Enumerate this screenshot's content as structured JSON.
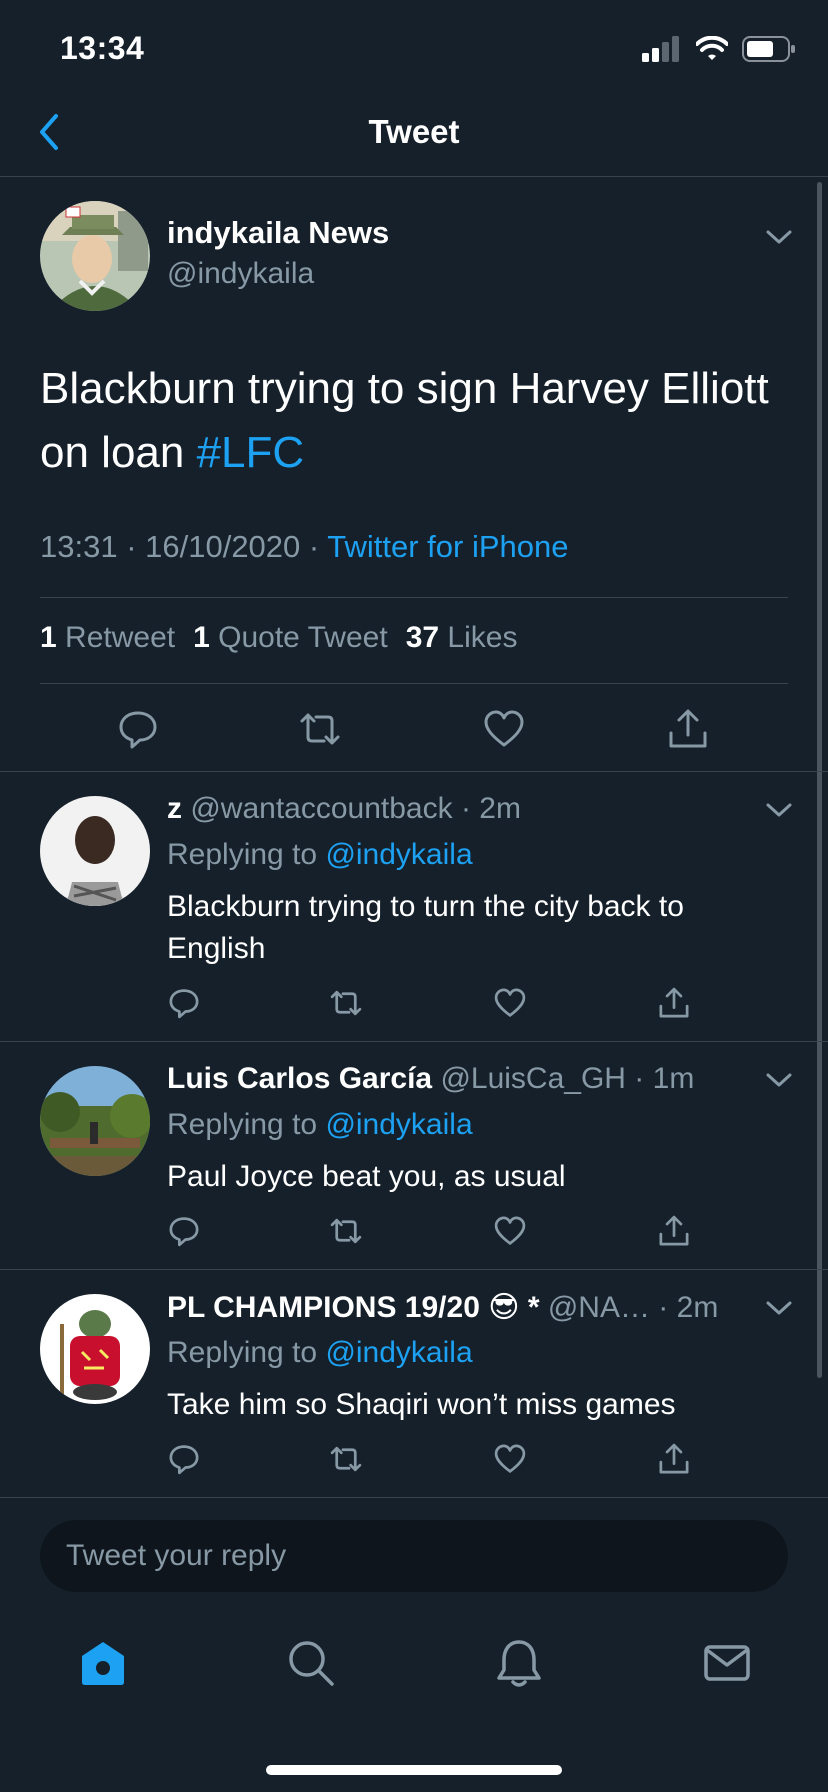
{
  "status_bar": {
    "time": "13:34"
  },
  "header": {
    "title": "Tweet"
  },
  "main_tweet": {
    "display_name": "indykaila  News",
    "handle": "@indykaila",
    "text": "Blackburn trying to sign Harvey Elliott on loan ",
    "hashtag": "#LFC",
    "time_date": "13:31 · 16/10/2020 · ",
    "source": "Twitter for iPhone",
    "retweets_count": "1",
    "retweets_label": "Retweet",
    "quotes_count": "1",
    "quotes_label": "Quote Tweet",
    "likes_count": "37",
    "likes_label": "Likes"
  },
  "replies": [
    {
      "name": "z",
      "handle": " @wantaccountback",
      "time": " · 2m",
      "replying_prefix": "Replying to ",
      "replying_handle": "@indykaila",
      "text": "Blackburn trying to turn the city back to English"
    },
    {
      "name": "Luis Carlos García",
      "handle": " @LuisCa_GH",
      "time": " · 1m",
      "replying_prefix": "Replying to ",
      "replying_handle": "@indykaila",
      "text": "Paul Joyce beat you, as usual"
    },
    {
      "name": "PL CHAMPIONS 19/20 😎 *",
      "handle": " @NA…",
      "time": " · 2m",
      "replying_prefix": "Replying to ",
      "replying_handle": "@indykaila",
      "text": "Take him so Shaqiri won’t miss games"
    }
  ],
  "compose": {
    "placeholder": "Tweet your reply"
  },
  "colors": {
    "background": "#15202b",
    "accent": "#1da1f2",
    "muted": "#8899a6",
    "divider": "#38444d"
  },
  "icons": {
    "tabbar": [
      "home-icon",
      "search-icon",
      "bell-icon",
      "mail-icon"
    ],
    "actions": [
      "reply-icon",
      "retweet-icon",
      "like-icon",
      "share-icon"
    ]
  }
}
